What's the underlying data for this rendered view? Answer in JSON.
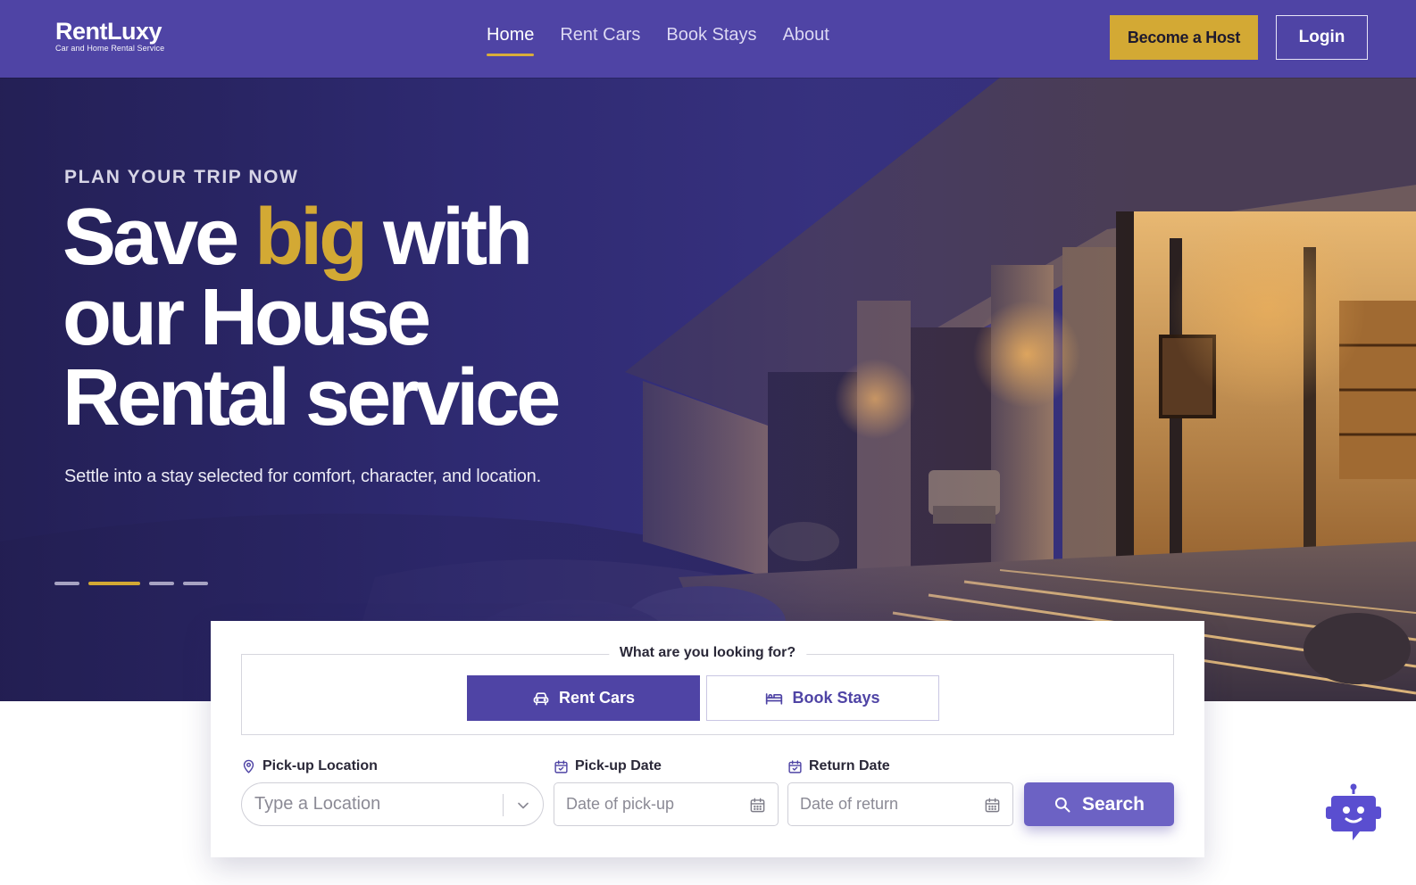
{
  "brand": {
    "name": "RentLuxy",
    "tagline": "Car and Home Rental Service"
  },
  "nav": {
    "links": [
      {
        "label": "Home",
        "active": true
      },
      {
        "label": "Rent Cars",
        "active": false
      },
      {
        "label": "Book Stays",
        "active": false
      },
      {
        "label": "About",
        "active": false
      }
    ],
    "host_button": "Become a Host",
    "login_button": "Login"
  },
  "hero": {
    "eyebrow": "PLAN YOUR TRIP NOW",
    "headline_part1": "Save ",
    "headline_accent": "big",
    "headline_part2": " with our House Rental service",
    "subtitle": "Settle into a stay selected for comfort, character, and location.",
    "slides_count": 4,
    "active_slide_index": 1
  },
  "search": {
    "question": "What are you looking for?",
    "tabs": [
      {
        "label": "Rent Cars",
        "icon": "car-icon",
        "selected": true
      },
      {
        "label": "Book Stays",
        "icon": "bed-icon",
        "selected": false
      }
    ],
    "pickup_location": {
      "label": "Pick-up Location",
      "placeholder": "Type a Location"
    },
    "pickup_date": {
      "label": "Pick-up Date",
      "placeholder": "Date of pick-up"
    },
    "return_date": {
      "label": "Return Date",
      "placeholder": "Date of return"
    },
    "submit_label": "Search"
  },
  "colors": {
    "primary": "#4f44a5",
    "accent_gold": "#d3a934",
    "search_button": "#6c62c4"
  }
}
